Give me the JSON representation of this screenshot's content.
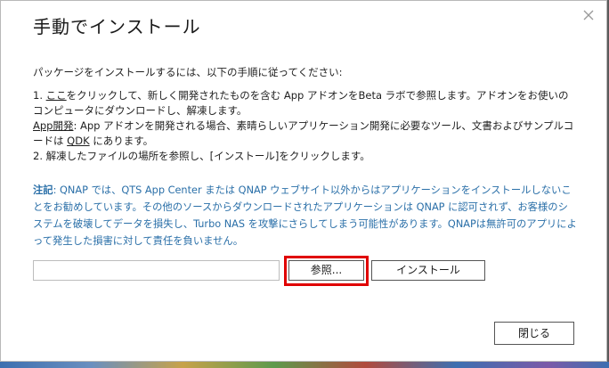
{
  "dialog": {
    "title": "手動でインストール",
    "intro": "パッケージをインストールするには、以下の手順に従ってください:",
    "steps": {
      "line1_a": "1. ",
      "line1_link": "ここ",
      "line1_b": "をクリックして、新しく開発されたものを含む App アドオンをBeta ラボで参照します。アドオンをお使いのコンピュータにダウンロードし、解凍します。",
      "line2_link": "App開発",
      "line2_b": ": App アドオンを開発される場合、素晴らしいアプリケーション開発に必要なツール、文書およびサンプルコードは ",
      "line2_qdk": "QDK",
      "line2_c": " にあります。",
      "line3": "2. 解凍したファイルの場所を参照し、[インストール]をクリックします。"
    },
    "note": {
      "label": "注記",
      "text": ": QNAP では、QTS App Center または QNAP ウェブサイト以外からはアプリケーションをインストールしないことをお勧めしています。その他のソースからダウンロードされたアプリケーションは QNAP に認可されず、お客様のシステムを破壊してデータを損失し、Turbo NAS を攻撃にさらしてしまう可能性があります。QNAPは無許可のアプリによって発生した損害に対して責任を負いません。"
    },
    "file_input": {
      "value": "",
      "placeholder": ""
    },
    "browse_label": "参照...",
    "install_label": "インストール",
    "close_label": "閉じる"
  },
  "colors": {
    "note_text": "#2a6fa8",
    "highlight_border": "#e00000"
  },
  "icons": {
    "close": "close-icon"
  }
}
